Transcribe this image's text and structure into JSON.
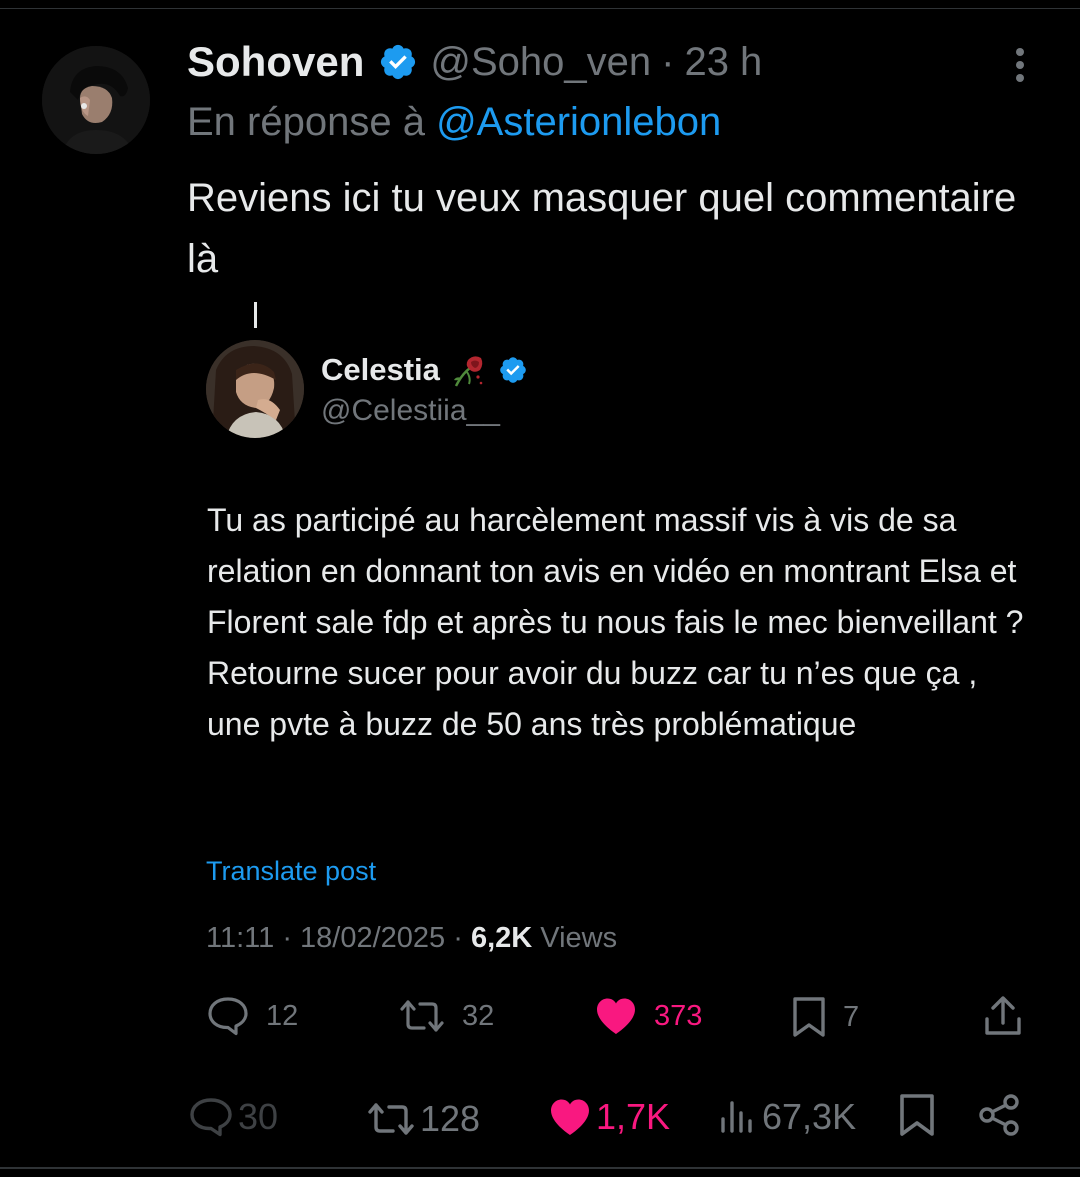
{
  "author": {
    "name": "Sohoven",
    "handle": "@Soho_ven",
    "separator": "·",
    "time": "23 h",
    "verified_icon": "verified-badge-icon"
  },
  "reply": {
    "prefix": "En réponse à",
    "handle": "@Asterionlebon"
  },
  "tweet": {
    "text": "Reviens ici tu veux masquer quel commentaire là"
  },
  "quoted": {
    "name": "Celestia",
    "name_emoji": "wilted-rose-icon",
    "handle": "@Celestiia__",
    "text": "Tu as participé au harcèlement massif vis à vis de sa relation en donnant ton avis en vidéo en montrant Elsa et Florent sale fdp et après tu nous fais le mec bienveillant ? Retourne sucer pour avoir du buzz car tu n’es que ça , une pvte à buzz de 50 ans très problématique",
    "translate_label": "Translate post",
    "timestamp": "11:11 · 18/02/2025 ·",
    "views_count": "6,2K",
    "views_label": "Views",
    "actions": {
      "replies": "12",
      "reposts": "32",
      "likes": "373",
      "bookmarks": "7"
    }
  },
  "bottom_actions": {
    "replies": "30",
    "reposts": "128",
    "likes": "1,7K",
    "views": "67,3K"
  },
  "colors": {
    "background": "#000000",
    "text": "#e7e9ea",
    "muted": "#71767b",
    "link": "#1d9bf0",
    "like": "#f91880"
  }
}
